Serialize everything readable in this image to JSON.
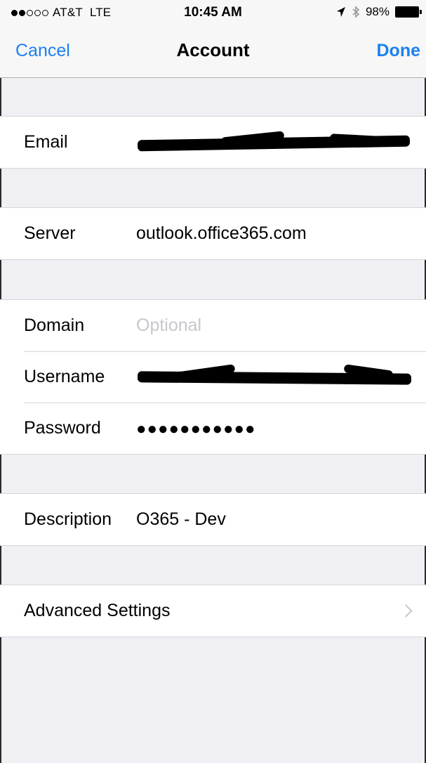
{
  "status_bar": {
    "carrier": "AT&T",
    "network": "LTE",
    "time": "10:45 AM",
    "battery_percent": "98%",
    "signal_bars_filled": 2,
    "signal_bars_total": 5
  },
  "nav": {
    "cancel_label": "Cancel",
    "title": "Account",
    "done_label": "Done"
  },
  "fields": {
    "email": {
      "label": "Email",
      "value": ""
    },
    "server": {
      "label": "Server",
      "value": "outlook.office365.com"
    },
    "domain": {
      "label": "Domain",
      "placeholder": "Optional"
    },
    "username": {
      "label": "Username",
      "value": ""
    },
    "password": {
      "label": "Password",
      "value": "●●●●●●●●●●●"
    },
    "description": {
      "label": "Description",
      "value": "O365 - Dev"
    }
  },
  "advanced": {
    "label": "Advanced Settings"
  },
  "colors": {
    "accent": "#1b80f3",
    "background": "#efeff4",
    "placeholder": "#c7c7cd"
  }
}
